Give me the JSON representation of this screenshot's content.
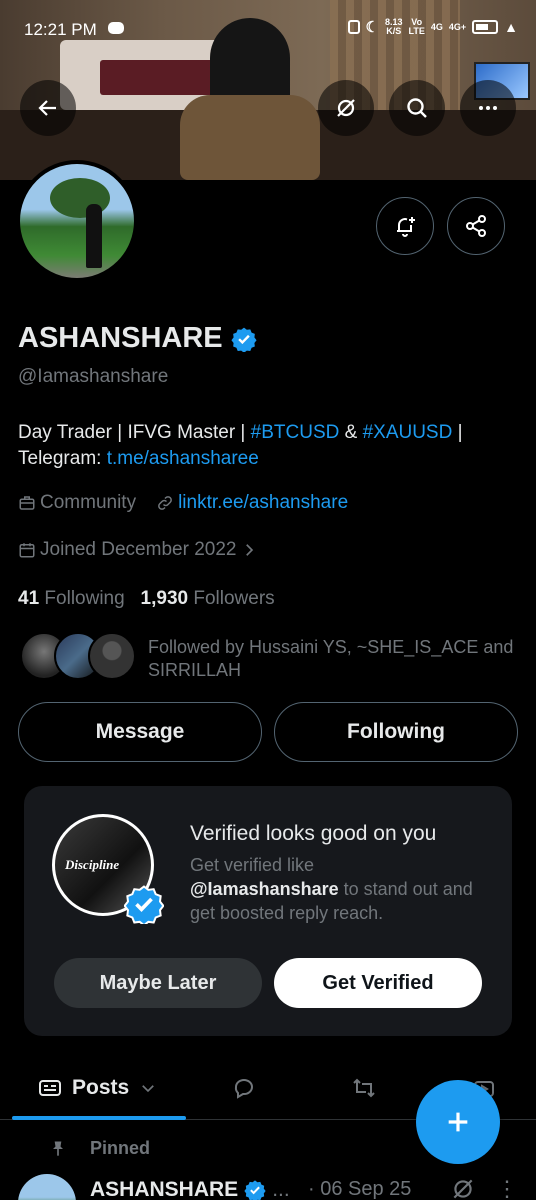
{
  "status_bar": {
    "time": "12:21 PM",
    "speed_value": "8.13",
    "speed_unit": "K/S",
    "vo": "Vo",
    "lte": "LTE",
    "net1": "4G",
    "net2": "4G+"
  },
  "header": {
    "icons": [
      "back-arrow-icon",
      "grok-icon",
      "search-icon",
      "more-icon"
    ]
  },
  "profile": {
    "name": "ASHANSHARE",
    "handle": "@Iamashanshare",
    "bio_prefix": "Day Trader | IFVG Master | ",
    "bio_tag1": "#BTCUSD",
    "bio_amp": " & ",
    "bio_tag2": "#XAUUSD",
    "bio_pipe": " |",
    "bio_telegram_label": "Telegram: ",
    "bio_telegram_link": "t.me/ashansharee",
    "category": "Community",
    "website": "linktr.ee/ashanshare",
    "joined": "Joined December 2022",
    "following_count": "41",
    "following_label": "Following",
    "followers_count": "1,930",
    "followers_label": "Followers",
    "followed_by": "Followed by Hussaini YS, ~SHE_IS_ACE and SIRRILLAH"
  },
  "actions": {
    "message": "Message",
    "following": "Following"
  },
  "verify_card": {
    "title": "Verified looks good on you",
    "text_prefix": "Get verified like",
    "text_handle": "@Iamashanshare",
    "text_suffix": " to stand out and get boosted reply reach.",
    "avatar_text": "Discipline",
    "maybe_later": "Maybe Later",
    "get_verified": "Get Verified"
  },
  "tabs": {
    "posts": "Posts"
  },
  "pinned_label": "Pinned",
  "post": {
    "name": "ASHANSHARE",
    "ellipsis": "...",
    "date": "· 06 Sep 25",
    "more": "⋮"
  },
  "colors": {
    "accent": "#1d9bf0",
    "background": "#000000",
    "muted": "#71767b",
    "text": "#e7e9ea"
  }
}
